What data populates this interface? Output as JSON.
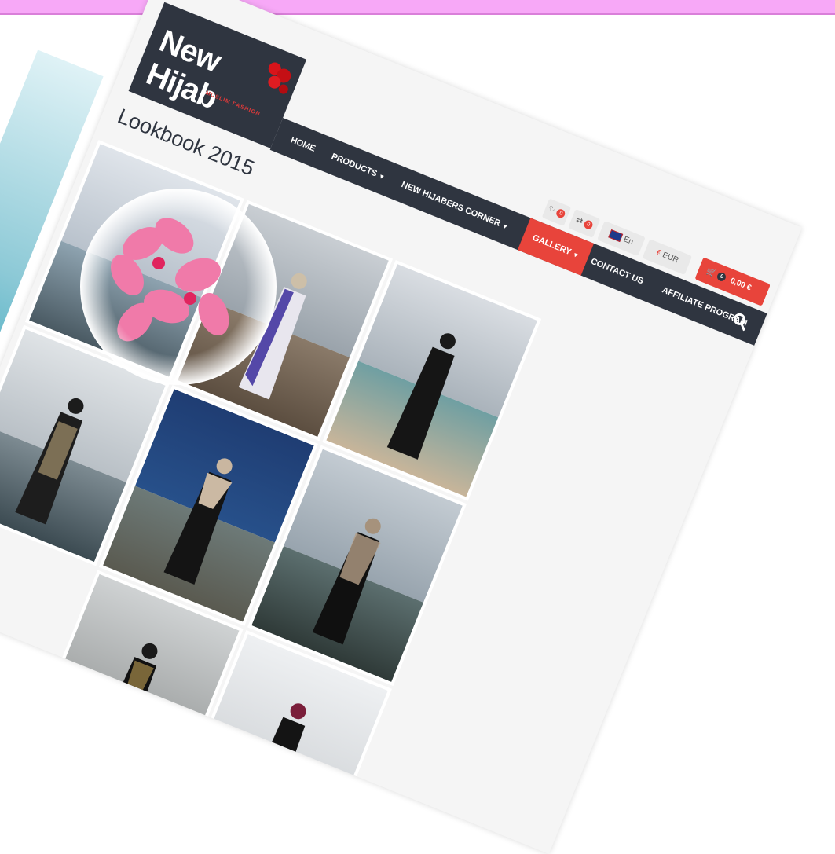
{
  "site": {
    "logo_text": "New Hijab",
    "logo_tagline": "MUSLIM FASHION",
    "page_title": "Lookbook 2015"
  },
  "nav": {
    "items": [
      {
        "label": "HOME",
        "caret": false,
        "active": false
      },
      {
        "label": "PRODUCTS",
        "caret": true,
        "active": false
      },
      {
        "label": "NEW HIJABERS CORNER",
        "caret": true,
        "active": false
      },
      {
        "label": "GALLERY",
        "caret": true,
        "active": true
      },
      {
        "label": "CONTACT US",
        "caret": false,
        "active": false
      },
      {
        "label": "AFFILIATE PROGRAM",
        "caret": false,
        "active": false
      }
    ]
  },
  "utility": {
    "wishlist_count": "0",
    "compare_count": "0",
    "language": "En",
    "currency_symbol": "€",
    "currency": "EUR",
    "cart_count": "0",
    "cart_total": "0,00 €"
  },
  "colors": {
    "dark": "#2f3540",
    "accent": "#e8443b",
    "page_bg": "#f5f5f5"
  }
}
